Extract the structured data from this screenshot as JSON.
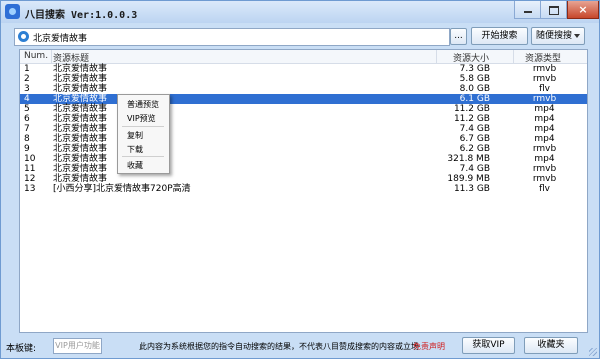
{
  "window": {
    "title": "八目搜索 Ver:1.0.0.3",
    "close_glyph": "×"
  },
  "search": {
    "value": "北京爱情故事"
  },
  "toolbar": {
    "more_label": "...",
    "start_label": "开始搜索",
    "random_label": "随便搜搜"
  },
  "table": {
    "headers": {
      "num": "Num.",
      "title": "资源标题",
      "size": "资源大小",
      "type": "资源类型"
    },
    "rows": [
      {
        "num": "1",
        "title": "北京爱情故事",
        "size": "7.3 GB",
        "type": "rmvb"
      },
      {
        "num": "2",
        "title": "北京爱情故事",
        "size": "5.8 GB",
        "type": "rmvb"
      },
      {
        "num": "3",
        "title": "北京爱情故事",
        "size": "8.0 GB",
        "type": "flv"
      },
      {
        "num": "4",
        "title": "北京爱情故事",
        "size": "6.1 GB",
        "type": "rmvb",
        "selected": true
      },
      {
        "num": "5",
        "title": "北京爱情故事",
        "size": "11.2 GB",
        "type": "mp4"
      },
      {
        "num": "6",
        "title": "北京爱情故事",
        "size": "11.2 GB",
        "type": "mp4"
      },
      {
        "num": "7",
        "title": "北京爱情故事",
        "size": "7.4 GB",
        "type": "mp4"
      },
      {
        "num": "8",
        "title": "北京爱情故事",
        "size": "6.7 GB",
        "type": "mp4"
      },
      {
        "num": "9",
        "title": "北京爱情故事",
        "size": "6.2 GB",
        "type": "rmvb"
      },
      {
        "num": "10",
        "title": "北京爱情故事",
        "size": "321.8 MB",
        "type": "mp4"
      },
      {
        "num": "11",
        "title": "北京爱情故事",
        "size": "7.4 GB",
        "type": "rmvb"
      },
      {
        "num": "12",
        "title": "北京爱情故事",
        "size": "189.9 MB",
        "type": "rmvb"
      },
      {
        "num": "13",
        "title": "[小西分享]北京爱情故事720P高清",
        "size": "11.3 GB",
        "type": "flv"
      }
    ]
  },
  "context_menu": {
    "items": [
      "普通预览",
      "VIP预览",
      "复制",
      "下载",
      "收藏"
    ]
  },
  "footer": {
    "key_label": "本板键:",
    "key_placeholder": "VIP用户功能",
    "disclaimer": "此内容为系统根据您的指令自动搜索的结果，不代表八目赞成搜索的内容或立场",
    "disclaimer_link": "免责声明",
    "vip_button": "获取VIP",
    "favorites_button": "收藏夹"
  }
}
